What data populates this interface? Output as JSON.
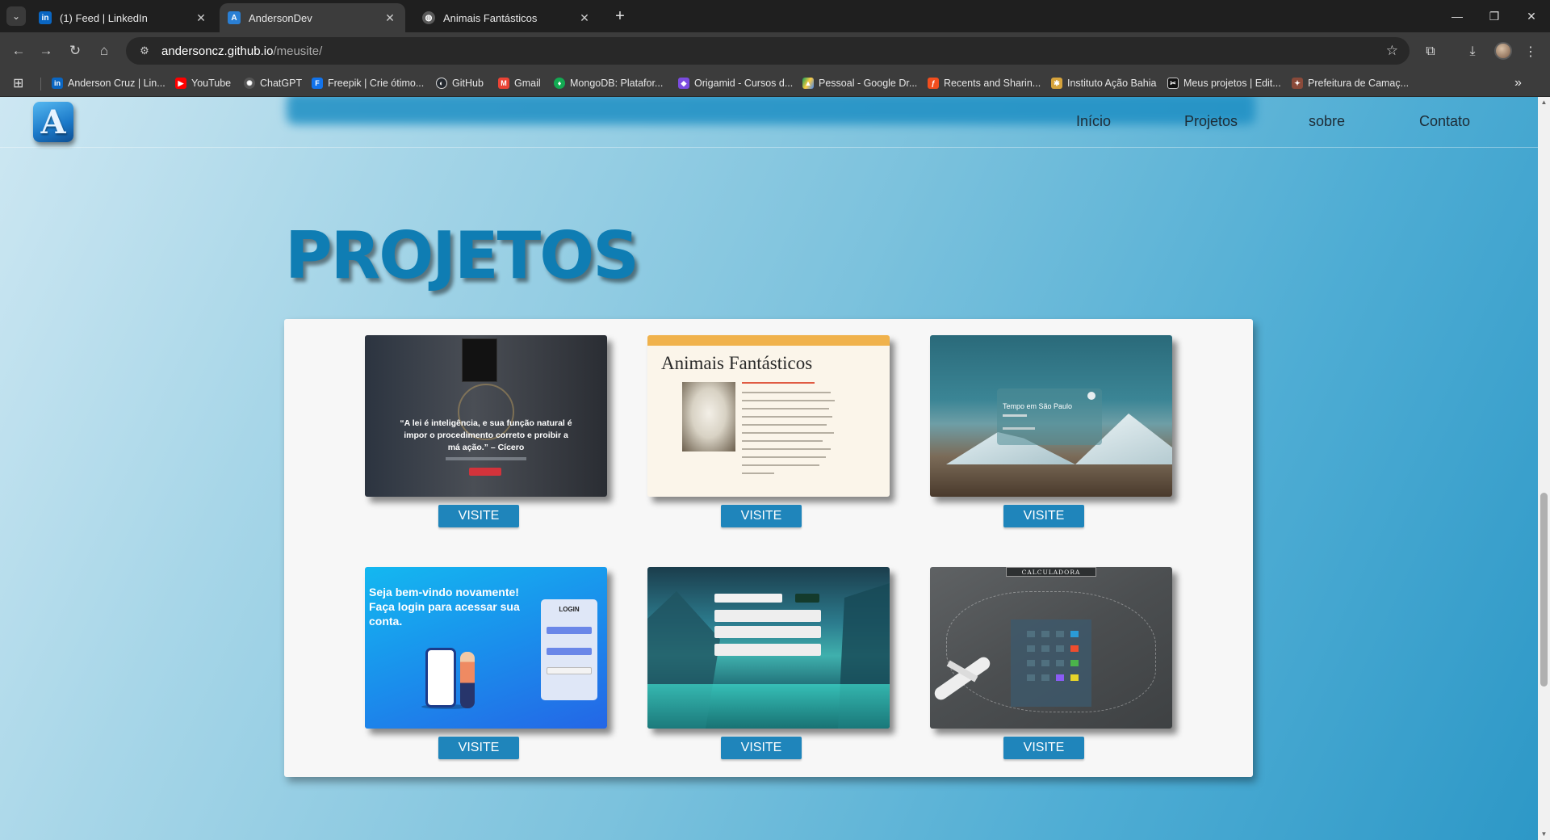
{
  "browser": {
    "tabs": [
      {
        "title": "(1) Feed | LinkedIn",
        "icon": "linkedin-icon",
        "active": false
      },
      {
        "title": "AndersonDev",
        "icon": "site-favicon-icon",
        "active": true
      },
      {
        "title": "Animais Fantásticos",
        "icon": "globe-icon",
        "active": false
      }
    ],
    "url_host": "andersoncz.github.io",
    "url_path": "/meusite/",
    "bookmarks": [
      {
        "label": "Anderson Cruz | Lin...",
        "icon": "linkedin-icon"
      },
      {
        "label": "YouTube",
        "icon": "youtube-icon"
      },
      {
        "label": "ChatGPT",
        "icon": "chatgpt-icon"
      },
      {
        "label": "Freepik | Crie ótimo...",
        "icon": "freepik-icon"
      },
      {
        "label": "GitHub",
        "icon": "github-icon"
      },
      {
        "label": "Gmail",
        "icon": "gmail-icon"
      },
      {
        "label": "MongoDB: Platafor...",
        "icon": "mongodb-icon"
      },
      {
        "label": "Origamid - Cursos d...",
        "icon": "origamid-icon"
      },
      {
        "label": "Pessoal - Google Dr...",
        "icon": "google-drive-icon"
      },
      {
        "label": "Recents and Sharin...",
        "icon": "figma-icon"
      },
      {
        "label": "Instituto Ação Bahia",
        "icon": "instituto-icon"
      },
      {
        "label": "Meus projetos | Edit...",
        "icon": "capcut-icon"
      },
      {
        "label": "Prefeitura de Camaç...",
        "icon": "prefeitura-icon"
      }
    ]
  },
  "site": {
    "logo_letter": "A",
    "nav": [
      "Início",
      "Projetos",
      "sobre",
      "Contato"
    ],
    "section_title": "PROJETOS",
    "visit_label": "VISITE",
    "projects": [
      {
        "name": "law-firm",
        "quote": "“A lei é inteligência, e sua função natural é impor o procedimento correto e proibir a má ação.” – Cícero"
      },
      {
        "name": "animais-fantasticos",
        "heading": "Animais Fantásticos"
      },
      {
        "name": "weather",
        "widget_title": "Tempo em São Paulo"
      },
      {
        "name": "login",
        "message": "Seja bem-vindo novamente! Faça login para acessar sua conta.",
        "form_title": "LOGIN"
      },
      {
        "name": "todo-list"
      },
      {
        "name": "calculator",
        "title": "CALCULADORA"
      }
    ]
  },
  "colors": {
    "accent": "#1f85bb",
    "title": "#0f7db3",
    "chrome_bg": "#3c3c3c"
  }
}
